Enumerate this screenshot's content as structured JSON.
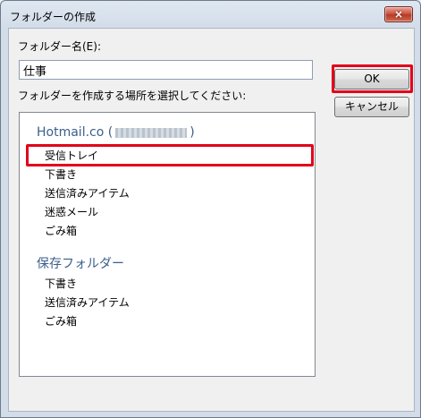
{
  "window": {
    "title": "フォルダーの作成",
    "close_label": "×"
  },
  "form": {
    "name_label": "フォルダー名(E):",
    "name_value": "仕事",
    "location_label": "フォルダーを作成する場所を選択してください:"
  },
  "tree": {
    "account": "Hotmail.co (",
    "account_suffix": ")",
    "account_items": [
      "受信トレイ",
      "下書き",
      "送信済みアイテム",
      "迷惑メール",
      "ごみ箱"
    ],
    "section": "保存フォルダー",
    "section_items": [
      "下書き",
      "送信済みアイテム",
      "ごみ箱"
    ]
  },
  "buttons": {
    "ok": "OK",
    "cancel": "キャンセル"
  },
  "colors": {
    "highlight": "#e3001b",
    "tree_header": "#3b5f8a"
  }
}
